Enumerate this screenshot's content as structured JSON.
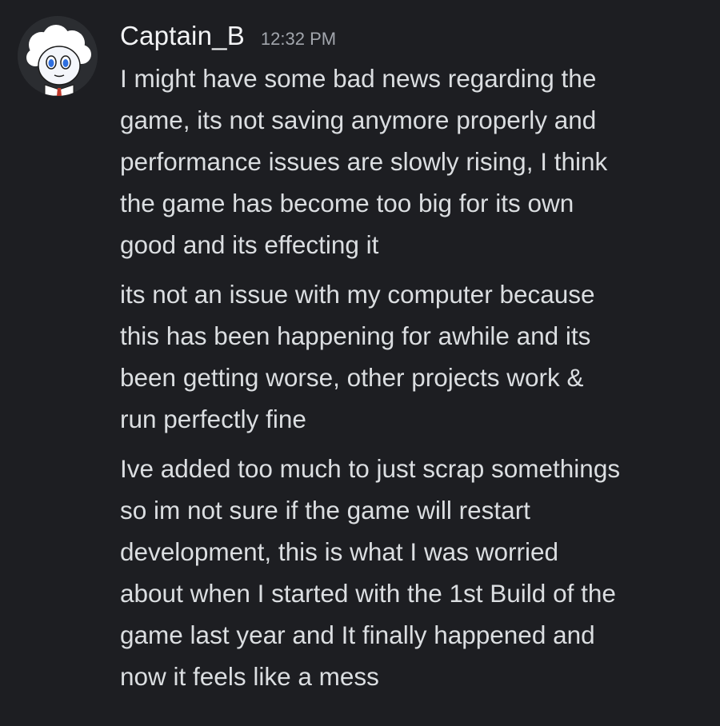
{
  "author": {
    "username": "Captain_B",
    "timestamp": "12:32 PM"
  },
  "colors": {
    "background": "#1d1e22",
    "username": "#f2f3f5",
    "timestamp": "#a2a6ad",
    "message_text": "#dbdee1"
  },
  "avatar_icon": "cartoon-character-avatar",
  "messages": [
    {
      "lines": [
        "I might have some bad news regarding the",
        "game, its not saving anymore properly and",
        "performance issues are slowly rising, I think",
        "the game has become too big for its own",
        "good and its effecting it"
      ]
    },
    {
      "lines": [
        "its not an issue with my computer because",
        "this has been happening for awhile and its",
        "been getting worse, other projects work &",
        "run perfectly fine"
      ]
    },
    {
      "lines": [
        "Ive added too much to just scrap somethings",
        "so im not sure if the game will restart",
        "development, this is what I was worried",
        "about when I started with the 1st Build of the",
        "game last year and It finally happened and",
        "now it feels like a mess"
      ]
    }
  ]
}
